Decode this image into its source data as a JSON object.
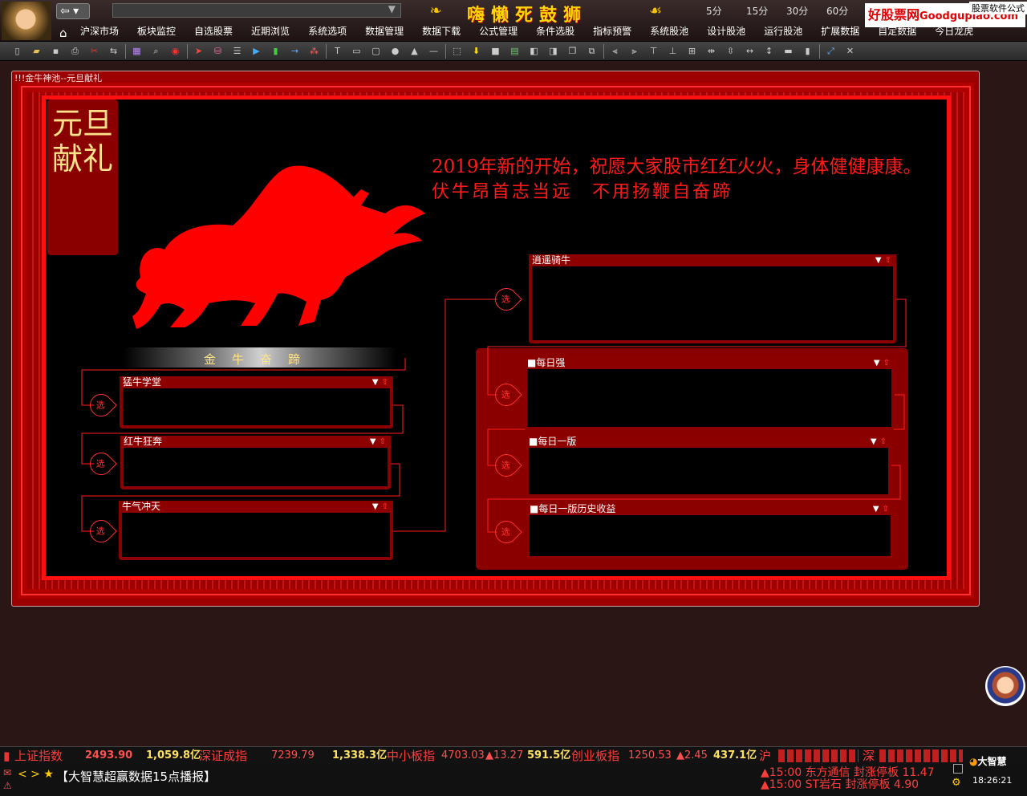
{
  "topbar": {
    "back_arrow": "⇦ ▾",
    "address_dropdown": "▼",
    "logo_text": "嗨懒死鼓狮",
    "periods": [
      "5分",
      "15分",
      "30分",
      "60分"
    ],
    "brand": "好股票网",
    "brand_domain": "Goodgupiao.com",
    "brand_sub": "股票软件公式"
  },
  "menu": {
    "home_icon": "home-icon",
    "items": [
      "沪深市场",
      "板块监控",
      "自选股票",
      "近期浏览",
      "系统选项",
      "数据管理",
      "数据下载",
      "公式管理",
      "条件选股",
      "指标预警",
      "系统股池",
      "设计股池",
      "运行股池",
      "扩展数据",
      "自定数据",
      "今日龙虎"
    ]
  },
  "panel": {
    "title": "!!!金牛神池--元旦献礼",
    "vertical_title": "元旦献礼",
    "bull_label": "金牛奋蹄",
    "greeting": "2019年新的开始，祝愿大家股市红红火火，身体健健康康。",
    "slogan": "伏牛昂首志当远　不用扬鞭自奋蹄"
  },
  "nodes": {
    "glyph": "选"
  },
  "boxes": {
    "mengniu": "猛牛学堂",
    "hongniu": "红牛狂奔",
    "niuqi": "牛气冲天",
    "xiaoyao": "逍遥骑牛",
    "meiriqiang": "■每日强",
    "meiriyiban": "■每日一版",
    "meiriyiban_hist": "■每日一版历史收益"
  },
  "box_controls": {
    "dropdown": "▼",
    "pin": "⇧"
  },
  "statusbar": {
    "sh_name": "上证指数",
    "sh_value": "2493.90",
    "sh_amount": "1,059.8亿",
    "sz_name": "深证成指",
    "sz_value": "7239.79",
    "sz_amount": "1,338.3亿",
    "zx_name": "中小板指",
    "zx_value": "4703.03",
    "zx_change": "▲13.27",
    "zx_amount": "591.5亿",
    "cy_name": "创业板指",
    "cy_value": "1250.53",
    "cy_change": "▲2.45",
    "cy_amount": "437.1亿",
    "sh_short": "沪",
    "sz_short": "深",
    "ticker": "【大智慧超赢数据15点播报】",
    "nav": "< > ★",
    "marquee1": "▲15:00 东方通信 封涨停板 11.47",
    "marquee2": "▲15:00 ST岩石  封涨停板 4.90",
    "clock": "18:26:21",
    "dzh_logo": "大智慧"
  },
  "colors": {
    "accent_red": "#ff1a1a",
    "panel_red": "#9c0000",
    "gold": "#ffd700",
    "value_red": "#ff5050",
    "value_yellow": "#ffe060"
  }
}
